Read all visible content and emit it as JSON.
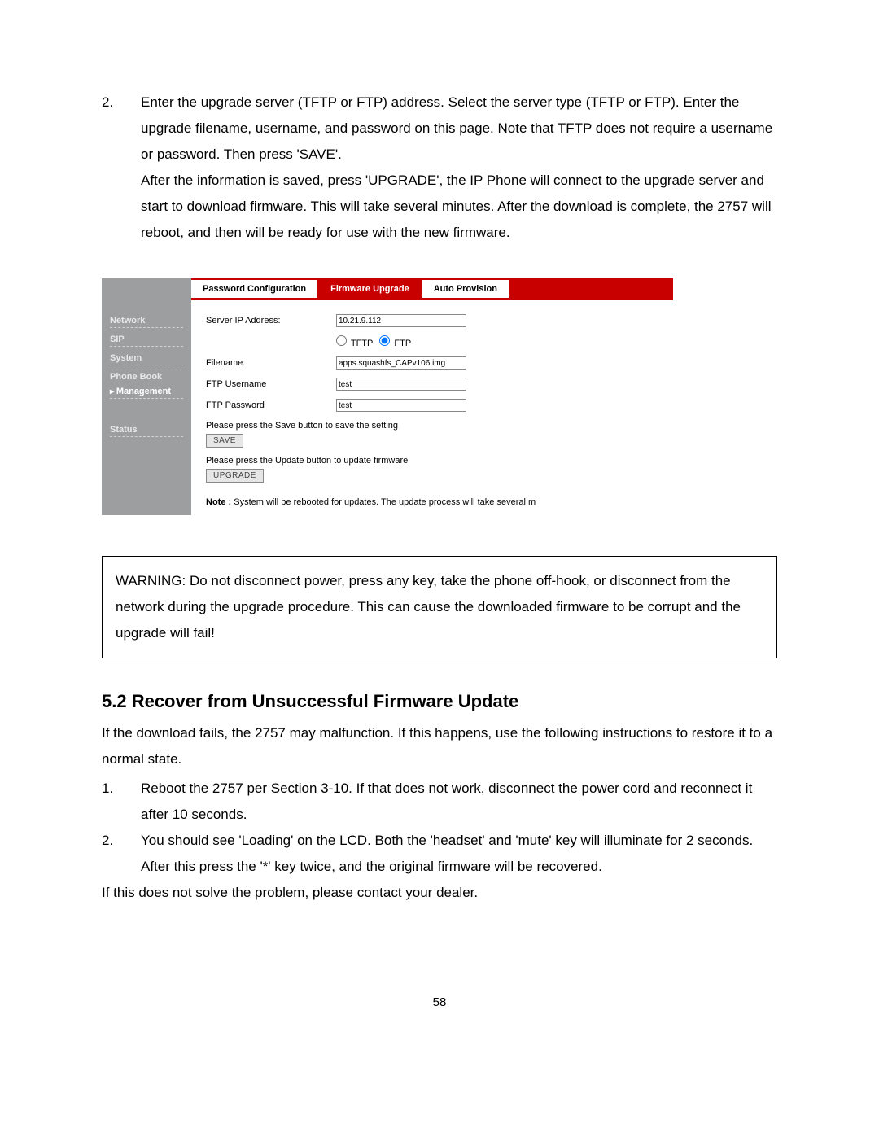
{
  "intro": {
    "step_num": "2.",
    "text": "Enter the upgrade server (TFTP or FTP) address.   Select the server type (TFTP or FTP). Enter the upgrade filename, username, and password on this page.   Note that TFTP does not require a username or password.   Then press 'SAVE'.\nAfter the information is saved, press 'UPGRADE', the IP Phone will connect to the upgrade server and start to download firmware.   This will take several minutes.   After the download is complete, the 2757 will reboot, and then will be ready for use with the new firmware."
  },
  "app": {
    "sidebar": {
      "items": [
        {
          "label": "Network",
          "dashed": true
        },
        {
          "label": "SIP",
          "dashed": true
        },
        {
          "label": "System",
          "dashed": true
        },
        {
          "label": "Phone Book",
          "dashed": false
        },
        {
          "label": "Management",
          "dashed": true,
          "active": true
        }
      ],
      "status_label": "Status"
    },
    "tabs": {
      "pw": "Password Configuration",
      "fw": "Firmware Upgrade",
      "ap": "Auto Provision"
    },
    "form": {
      "server_ip_label": "Server IP Address:",
      "server_ip_value": "10.21.9.112",
      "radio_tftp": "TFTP",
      "radio_ftp": "FTP",
      "filename_label": "Filename:",
      "filename_value": "apps.squashfs_CAPv106.img",
      "ftp_user_label": "FTP Username",
      "ftp_user_value": "test",
      "ftp_pass_label": "FTP Password",
      "ftp_pass_value": "test",
      "save_note": "Please press the Save button to save the setting",
      "save_btn": "SAVE",
      "upgrade_note": "Please press the Update button to update firmware",
      "upgrade_btn": "UPGRADE",
      "footnote_label": "Note :",
      "footnote_text": " System will be rebooted for updates. The update process will take several m"
    }
  },
  "warning": "WARNING: Do not disconnect power, press any key, take the phone off-hook, or disconnect from the network during the upgrade procedure.   This can cause the   downloaded firmware to be corrupt and the upgrade will fail!",
  "section": {
    "heading": "5.2 Recover from Unsuccessful Firmware Update",
    "intro": "If the download fails, the 2757 may malfunction. If this happens, use the following instructions to restore it to a normal state.",
    "step1_num": "1.",
    "step1": "Reboot the 2757 per Section 3-10.   If that does not work, disconnect the power cord and reconnect it after 10 seconds.",
    "step2_num": "2.",
    "step2": "You should see 'Loading' on the LCD.   Both the 'headset' and 'mute' key will illuminate for 2 seconds. After this press the '*' key twice, and the original firmware will be recovered.",
    "outro": "If this does not solve the problem, please contact your dealer."
  },
  "page_number": "58"
}
